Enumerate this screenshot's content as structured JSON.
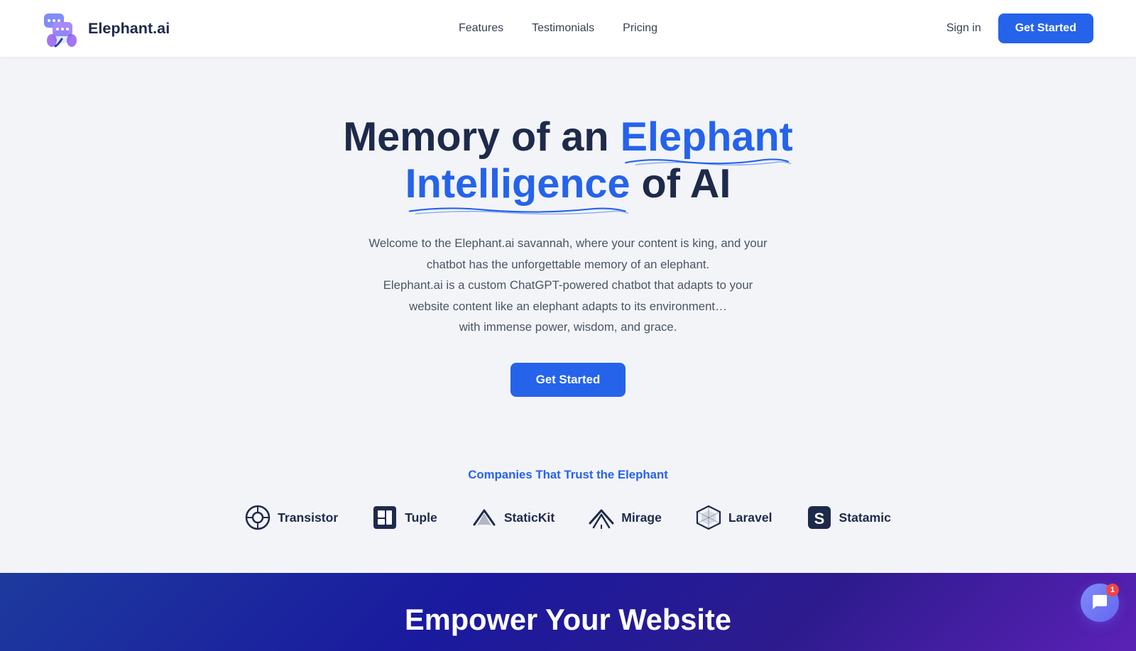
{
  "nav": {
    "logo_text": "Elephant.ai",
    "links": [
      {
        "label": "Features",
        "href": "#features"
      },
      {
        "label": "Testimonials",
        "href": "#testimonials"
      },
      {
        "label": "Pricing",
        "href": "#pricing"
      }
    ],
    "signin_label": "Sign in",
    "cta_label": "Get Started"
  },
  "hero": {
    "title_part1": "Memory of an ",
    "title_highlight1": "Elephant",
    "title_highlight2": "Intelligence",
    "title_part2": " of AI",
    "subtitle_line1": "Welcome to the Elephant.ai savannah, where your content is king, and your",
    "subtitle_line2": "chatbot has the unforgettable memory of an elephant.",
    "subtitle_line3": "Elephant.ai is a custom ChatGPT-powered chatbot that adapts to your",
    "subtitle_line4": "website content like an elephant adapts to its environment…",
    "subtitle_line5": "with immense power, wisdom, and grace.",
    "cta_label": "Get Started"
  },
  "companies": {
    "title": "Companies That Trust the Elephant",
    "logos": [
      {
        "name": "Transistor",
        "icon": "transistor"
      },
      {
        "name": "Tuple",
        "icon": "tuple"
      },
      {
        "name": "StaticKit",
        "icon": "statickit"
      },
      {
        "name": "Mirage",
        "icon": "mirage"
      },
      {
        "name": "Laravel",
        "icon": "laravel"
      },
      {
        "name": "Statamic",
        "icon": "statamic"
      }
    ]
  },
  "bottom_band": {
    "text": "Empower Your Website"
  },
  "chat_widget": {
    "badge": "1"
  },
  "colors": {
    "accent": "#2563eb",
    "dark": "#1e2a4a",
    "highlight": "#2563eb"
  }
}
